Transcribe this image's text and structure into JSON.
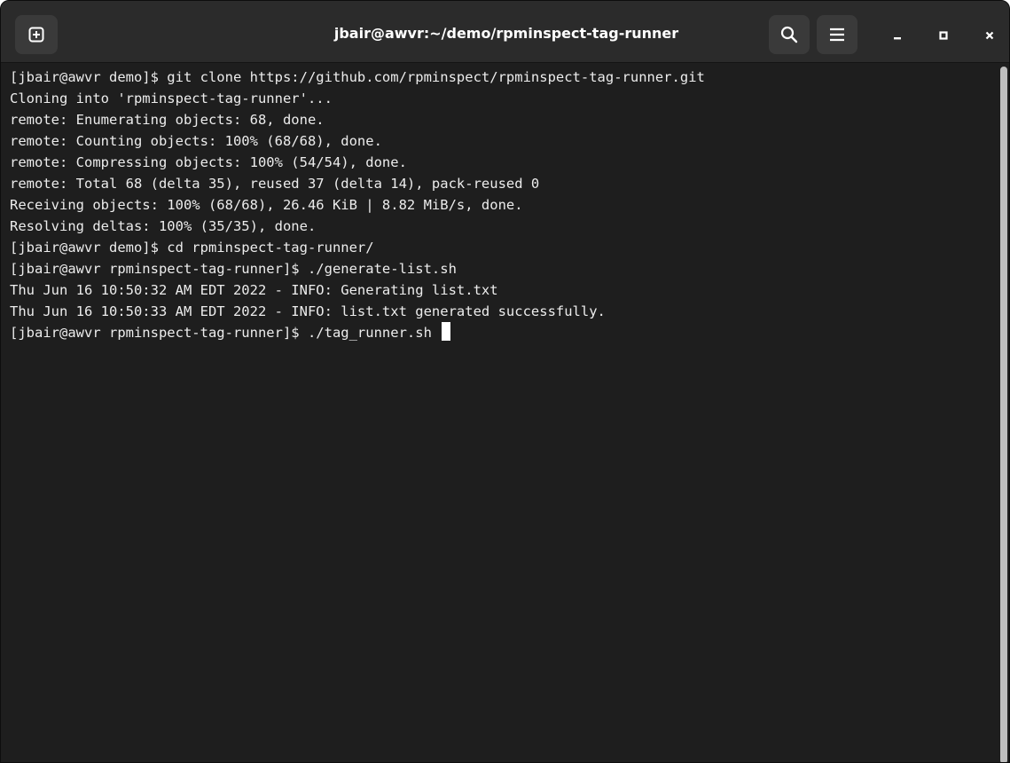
{
  "window": {
    "title": "jbair@awvr:~/demo/rpminspect-tag-runner"
  },
  "titlebar": {
    "new_tab_icon": "new-tab-icon",
    "search_icon": "search-icon",
    "menu_icon": "hamburger-menu-icon",
    "minimize_icon": "minimize-icon",
    "maximize_icon": "maximize-icon",
    "close_icon": "close-icon"
  },
  "terminal": {
    "lines": [
      "[jbair@awvr demo]$ git clone https://github.com/rpminspect/rpminspect-tag-runner.git",
      "Cloning into 'rpminspect-tag-runner'...",
      "remote: Enumerating objects: 68, done.",
      "remote: Counting objects: 100% (68/68), done.",
      "remote: Compressing objects: 100% (54/54), done.",
      "remote: Total 68 (delta 35), reused 37 (delta 14), pack-reused 0",
      "Receiving objects: 100% (68/68), 26.46 KiB | 8.82 MiB/s, done.",
      "Resolving deltas: 100% (35/35), done.",
      "[jbair@awvr demo]$ cd rpminspect-tag-runner/",
      "[jbair@awvr rpminspect-tag-runner]$ ./generate-list.sh",
      "Thu Jun 16 10:50:32 AM EDT 2022 - INFO: Generating list.txt",
      "Thu Jun 16 10:50:33 AM EDT 2022 - INFO: list.txt generated successfully.",
      "[jbair@awvr rpminspect-tag-runner]$ ./tag_runner.sh "
    ]
  },
  "colors": {
    "background": "#1e1e1e",
    "titlebar": "#2b2b2b",
    "text": "#ececec",
    "cursor": "#ffffff"
  }
}
